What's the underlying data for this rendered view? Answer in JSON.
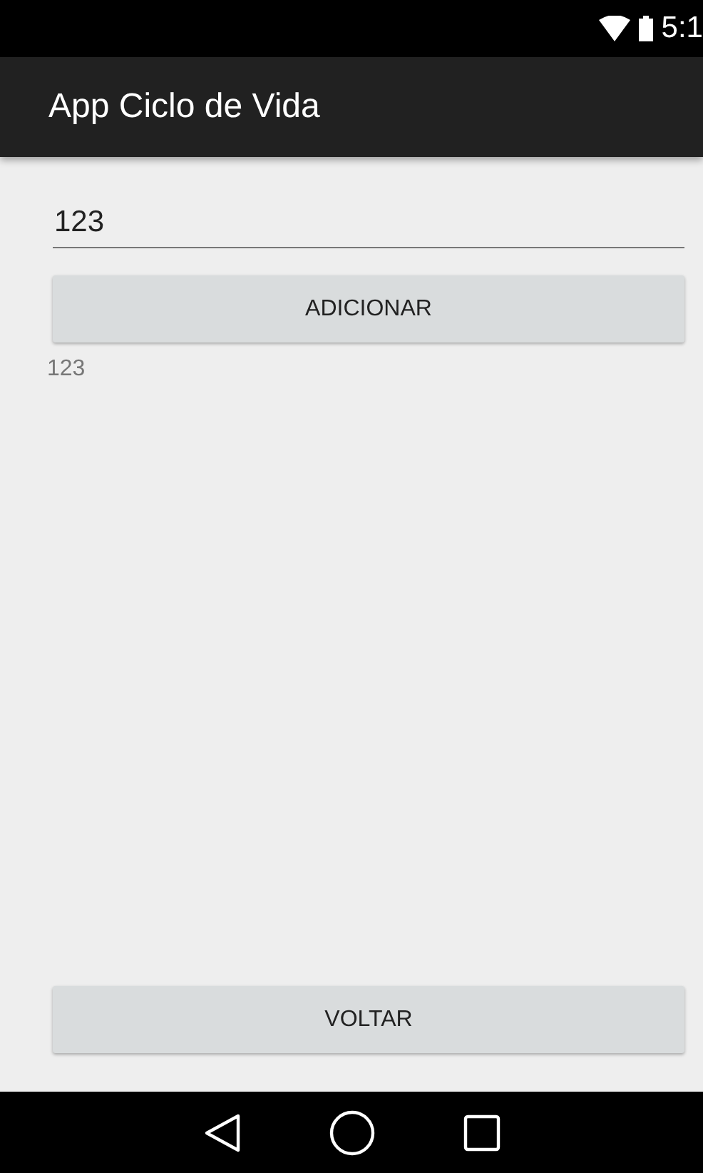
{
  "status_bar": {
    "time": "5:1"
  },
  "app_bar": {
    "title": "App Ciclo de Vida"
  },
  "input": {
    "value": "123"
  },
  "add_button": {
    "label": "ADICIONAR"
  },
  "output_text": "123",
  "back_button": {
    "label": "VOLTAR"
  }
}
